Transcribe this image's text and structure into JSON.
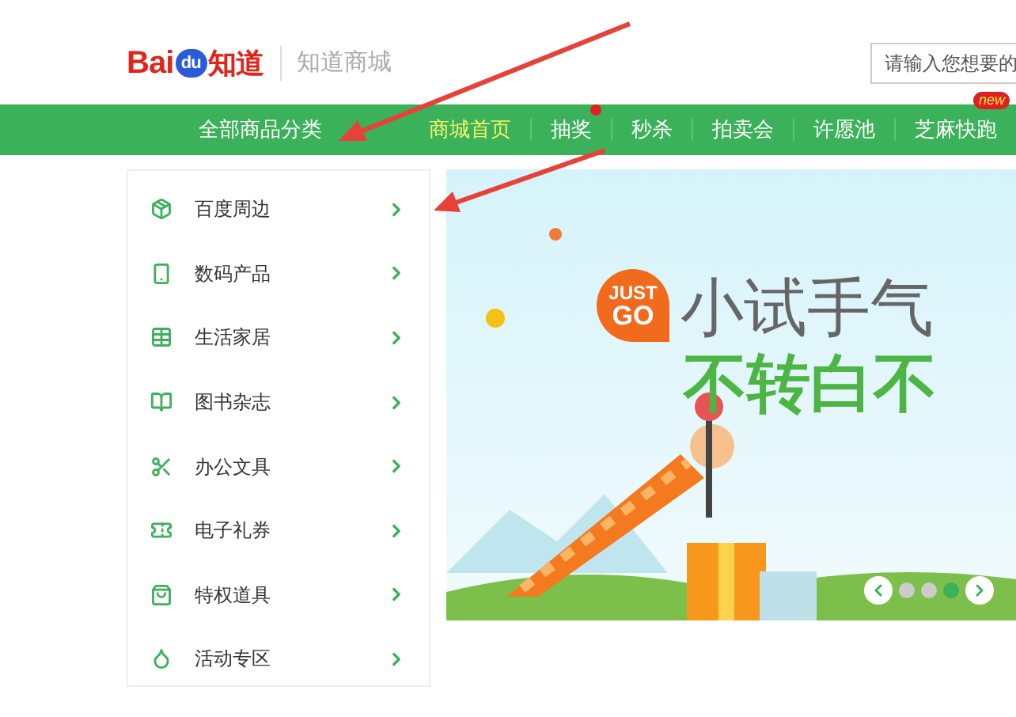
{
  "header": {
    "logo": {
      "text_1": "Bai",
      "badge": "du",
      "text_2": "知道"
    },
    "site_name": "知道商城",
    "search": {
      "placeholder": "请输入您想要的"
    }
  },
  "nav": {
    "category_menu": "全部商品分类",
    "items": [
      {
        "label": "商城首页",
        "selected": true,
        "notify_dot": false
      },
      {
        "label": "抽奖",
        "selected": false,
        "notify_dot": true
      },
      {
        "label": "秒杀",
        "selected": false,
        "notify_dot": false
      },
      {
        "label": "拍卖会",
        "selected": false,
        "notify_dot": false
      },
      {
        "label": "许愿池",
        "selected": false,
        "notify_dot": false
      },
      {
        "label": "芝麻快跑",
        "selected": false,
        "notify_dot": false,
        "badge": "new"
      }
    ]
  },
  "sidebar": {
    "items": [
      {
        "label": "百度周边",
        "kind": "box"
      },
      {
        "label": "数码产品",
        "kind": "device"
      },
      {
        "label": "生活家居",
        "kind": "table"
      },
      {
        "label": "图书杂志",
        "kind": "book"
      },
      {
        "label": "办公文具",
        "kind": "scissors"
      },
      {
        "label": "电子礼券",
        "kind": "card"
      },
      {
        "label": "特权道具",
        "kind": "bag"
      },
      {
        "label": "活动专区",
        "kind": "drop"
      }
    ]
  },
  "banner": {
    "badge_line_1": "JUST",
    "badge_line_2": "GO",
    "headline": "小试手气",
    "subline": "不转白不",
    "slides": [
      {
        "selected": false
      },
      {
        "selected": false
      },
      {
        "selected": true
      }
    ]
  }
}
